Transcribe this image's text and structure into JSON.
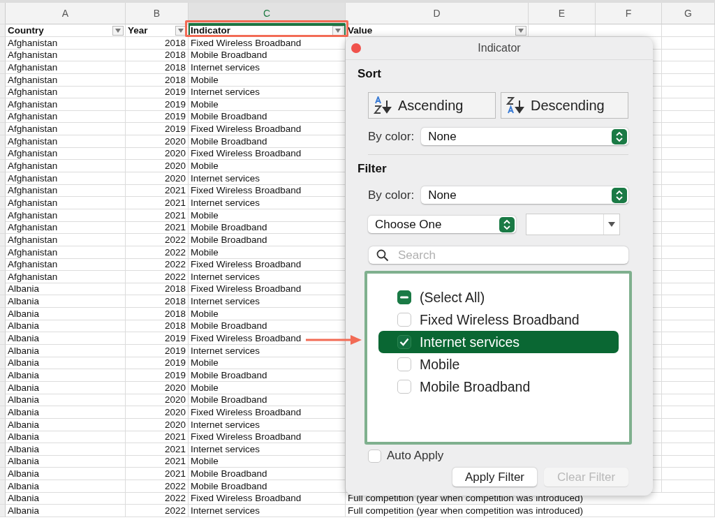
{
  "column_letters": [
    {
      "label": "A",
      "selected": false
    },
    {
      "label": "B",
      "selected": false
    },
    {
      "label": "C",
      "selected": true
    },
    {
      "label": "D",
      "selected": false
    },
    {
      "label": "E",
      "selected": false
    },
    {
      "label": "F",
      "selected": false
    },
    {
      "label": "G",
      "selected": false
    }
  ],
  "headers": [
    {
      "label": "Country",
      "selected": false
    },
    {
      "label": "Year",
      "selected": false
    },
    {
      "label": "Indicator",
      "selected": true
    },
    {
      "label": "Value",
      "selected": false
    }
  ],
  "rows": [
    {
      "country": "Afghanistan",
      "year": "2018",
      "indicator": "Fixed Wireless Broadband"
    },
    {
      "country": "Afghanistan",
      "year": "2018",
      "indicator": "Mobile Broadband"
    },
    {
      "country": "Afghanistan",
      "year": "2018",
      "indicator": "Internet services"
    },
    {
      "country": "Afghanistan",
      "year": "2018",
      "indicator": "Mobile"
    },
    {
      "country": "Afghanistan",
      "year": "2019",
      "indicator": "Internet services"
    },
    {
      "country": "Afghanistan",
      "year": "2019",
      "indicator": "Mobile"
    },
    {
      "country": "Afghanistan",
      "year": "2019",
      "indicator": "Mobile Broadband"
    },
    {
      "country": "Afghanistan",
      "year": "2019",
      "indicator": "Fixed Wireless Broadband"
    },
    {
      "country": "Afghanistan",
      "year": "2020",
      "indicator": "Mobile Broadband"
    },
    {
      "country": "Afghanistan",
      "year": "2020",
      "indicator": "Fixed Wireless Broadband"
    },
    {
      "country": "Afghanistan",
      "year": "2020",
      "indicator": "Mobile"
    },
    {
      "country": "Afghanistan",
      "year": "2020",
      "indicator": "Internet services"
    },
    {
      "country": "Afghanistan",
      "year": "2021",
      "indicator": "Fixed Wireless Broadband"
    },
    {
      "country": "Afghanistan",
      "year": "2021",
      "indicator": "Internet services"
    },
    {
      "country": "Afghanistan",
      "year": "2021",
      "indicator": "Mobile"
    },
    {
      "country": "Afghanistan",
      "year": "2021",
      "indicator": "Mobile Broadband"
    },
    {
      "country": "Afghanistan",
      "year": "2022",
      "indicator": "Mobile Broadband"
    },
    {
      "country": "Afghanistan",
      "year": "2022",
      "indicator": "Mobile"
    },
    {
      "country": "Afghanistan",
      "year": "2022",
      "indicator": "Fixed Wireless Broadband"
    },
    {
      "country": "Afghanistan",
      "year": "2022",
      "indicator": "Internet services"
    },
    {
      "country": "Albania",
      "year": "2018",
      "indicator": "Fixed Wireless Broadband"
    },
    {
      "country": "Albania",
      "year": "2018",
      "indicator": "Internet services"
    },
    {
      "country": "Albania",
      "year": "2018",
      "indicator": "Mobile"
    },
    {
      "country": "Albania",
      "year": "2018",
      "indicator": "Mobile Broadband"
    },
    {
      "country": "Albania",
      "year": "2019",
      "indicator": "Fixed Wireless Broadband"
    },
    {
      "country": "Albania",
      "year": "2019",
      "indicator": "Internet services"
    },
    {
      "country": "Albania",
      "year": "2019",
      "indicator": "Mobile"
    },
    {
      "country": "Albania",
      "year": "2019",
      "indicator": "Mobile Broadband"
    },
    {
      "country": "Albania",
      "year": "2020",
      "indicator": "Mobile"
    },
    {
      "country": "Albania",
      "year": "2020",
      "indicator": "Mobile Broadband"
    },
    {
      "country": "Albania",
      "year": "2020",
      "indicator": "Fixed Wireless Broadband"
    },
    {
      "country": "Albania",
      "year": "2020",
      "indicator": "Internet services"
    },
    {
      "country": "Albania",
      "year": "2021",
      "indicator": "Fixed Wireless Broadband"
    },
    {
      "country": "Albania",
      "year": "2021",
      "indicator": "Internet services"
    },
    {
      "country": "Albania",
      "year": "2021",
      "indicator": "Mobile"
    },
    {
      "country": "Albania",
      "year": "2021",
      "indicator": "Mobile Broadband"
    },
    {
      "country": "Albania",
      "year": "2022",
      "indicator": "Mobile Broadband"
    },
    {
      "country": "Albania",
      "year": "2022",
      "indicator": "Fixed Wireless Broadband",
      "value": "Full competition (year when competition was introduced)"
    },
    {
      "country": "Albania",
      "year": "2022",
      "indicator": "Internet services",
      "value": "Full competition (year when competition was introduced)"
    }
  ],
  "filter_panel": {
    "title": "Indicator",
    "sort": {
      "heading": "Sort",
      "ascending": "Ascending",
      "descending": "Descending",
      "by_color_label": "By color:",
      "by_color_value": "None"
    },
    "filter": {
      "heading": "Filter",
      "by_color_label": "By color:",
      "by_color_value": "None",
      "condition": "Choose One",
      "search": {
        "placeholder": "Search"
      },
      "items": [
        {
          "label": "(Select All)",
          "mixed": true,
          "selected": false
        },
        {
          "label": "Fixed Wireless Broadband",
          "checked": false,
          "selected": false
        },
        {
          "label": "Internet services",
          "checked": true,
          "selected": true
        },
        {
          "label": "Mobile",
          "checked": false,
          "selected": false
        },
        {
          "label": "Mobile Broadband",
          "checked": false,
          "selected": false
        }
      ]
    },
    "auto_apply": {
      "label": "Auto Apply",
      "checked": false
    },
    "buttons": [
      {
        "label": "Apply Filter",
        "disabled": false
      },
      {
        "label": "Clear Filter",
        "disabled": true
      }
    ]
  }
}
